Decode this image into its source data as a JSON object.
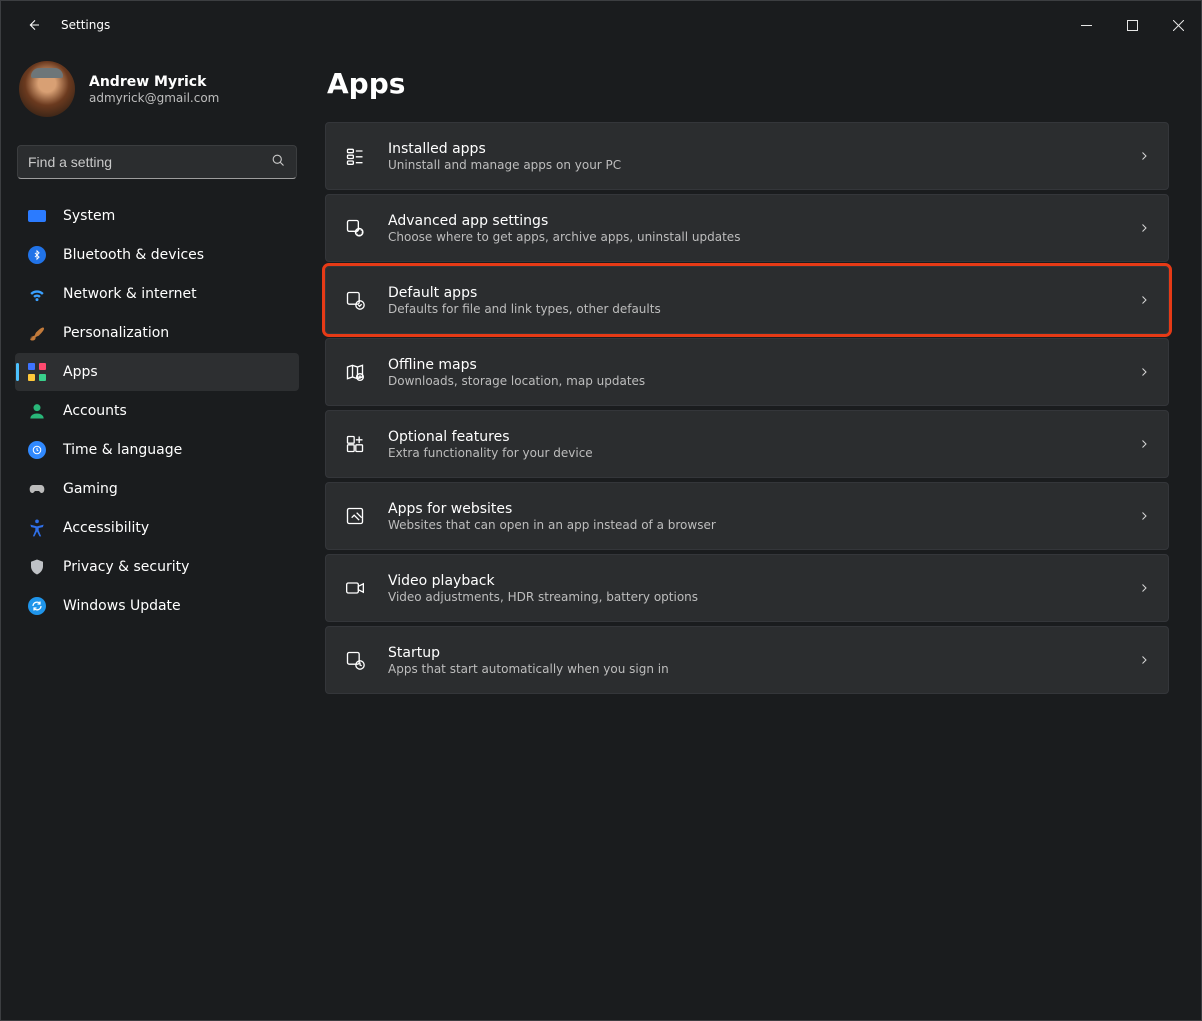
{
  "window": {
    "title": "Settings"
  },
  "profile": {
    "name": "Andrew Myrick",
    "email": "admyrick@gmail.com"
  },
  "search": {
    "placeholder": "Find a setting"
  },
  "nav": {
    "items": [
      {
        "id": "system",
        "label": "System"
      },
      {
        "id": "bluetooth",
        "label": "Bluetooth & devices"
      },
      {
        "id": "network",
        "label": "Network & internet"
      },
      {
        "id": "personalization",
        "label": "Personalization"
      },
      {
        "id": "apps",
        "label": "Apps"
      },
      {
        "id": "accounts",
        "label": "Accounts"
      },
      {
        "id": "time",
        "label": "Time & language"
      },
      {
        "id": "gaming",
        "label": "Gaming"
      },
      {
        "id": "accessibility",
        "label": "Accessibility"
      },
      {
        "id": "privacy",
        "label": "Privacy & security"
      },
      {
        "id": "update",
        "label": "Windows Update"
      }
    ],
    "active_id": "apps"
  },
  "page": {
    "title": "Apps",
    "cards": [
      {
        "id": "installed",
        "title": "Installed apps",
        "subtitle": "Uninstall and manage apps on your PC",
        "highlighted": false
      },
      {
        "id": "advanced",
        "title": "Advanced app settings",
        "subtitle": "Choose where to get apps, archive apps, uninstall updates",
        "highlighted": false
      },
      {
        "id": "default",
        "title": "Default apps",
        "subtitle": "Defaults for file and link types, other defaults",
        "highlighted": true
      },
      {
        "id": "maps",
        "title": "Offline maps",
        "subtitle": "Downloads, storage location, map updates",
        "highlighted": false
      },
      {
        "id": "optional",
        "title": "Optional features",
        "subtitle": "Extra functionality for your device",
        "highlighted": false
      },
      {
        "id": "websites",
        "title": "Apps for websites",
        "subtitle": "Websites that can open in an app instead of a browser",
        "highlighted": false
      },
      {
        "id": "video",
        "title": "Video playback",
        "subtitle": "Video adjustments, HDR streaming, battery options",
        "highlighted": false
      },
      {
        "id": "startup",
        "title": "Startup",
        "subtitle": "Apps that start automatically when you sign in",
        "highlighted": false
      }
    ]
  }
}
